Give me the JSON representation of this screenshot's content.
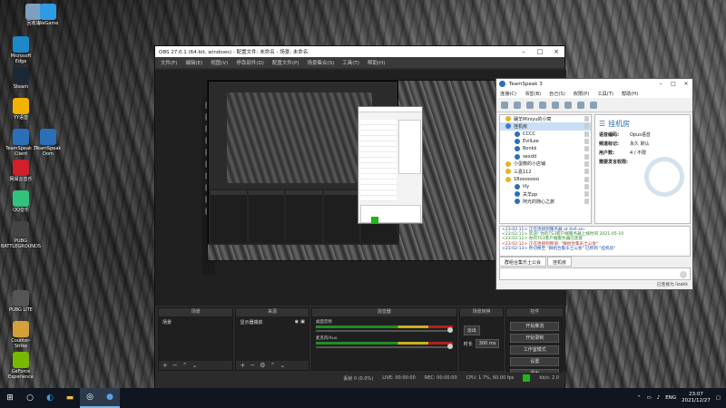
{
  "desktop": {
    "icons": [
      {
        "label": "回收站",
        "icon": "recycle-bin-icon",
        "color": "#7f9fbf"
      },
      {
        "label": "Microsoft Edge",
        "icon": "edge-icon",
        "color": "#1e88c8"
      },
      {
        "label": "Steam",
        "icon": "steam-icon",
        "color": "#1b2838"
      },
      {
        "label": "YY语音",
        "icon": "yy-icon",
        "color": "#f0b400"
      },
      {
        "label": "TeamSpeak 3 Client",
        "icon": "teamspeak-icon",
        "color": "#2a6fb8"
      },
      {
        "label": "网易云音乐",
        "icon": "netease-music-icon",
        "color": "#d0202a"
      },
      {
        "label": "QQ音乐",
        "icon": "qq-music-icon",
        "color": "#31c27c"
      },
      {
        "label": "PUBG BATTLEGROUNDS",
        "icon": "pubg-icon",
        "color": "#444444"
      },
      {
        "label": "PUBG LITE",
        "icon": "pubg-lite-icon",
        "color": "#555555"
      },
      {
        "label": "Counter-Strike",
        "icon": "cs-icon",
        "color": "#d4a03a"
      },
      {
        "label": "GeForce Experience",
        "icon": "geforce-icon",
        "color": "#76b900"
      },
      {
        "label": "WeGame",
        "icon": "wegame-icon",
        "color": "#2e9be4"
      },
      {
        "label": "TeamSpeak Dom",
        "icon": "teamspeak-icon",
        "color": "#2a6fb8"
      }
    ]
  },
  "obs": {
    "title": "OBS 27.0.1 (64-bit, windows) - 配置文件: 未命名 - 场景: 未命名",
    "menu": [
      "文件(F)",
      "编辑(E)",
      "视图(V)",
      "停靠部件(D)",
      "配置文件(P)",
      "场景集合(S)",
      "工具(T)",
      "帮助(H)"
    ],
    "panels": {
      "scenes": {
        "title": "场景",
        "items": [
          "场景"
        ]
      },
      "sources": {
        "title": "来源",
        "items": [
          "显示器捕获"
        ]
      },
      "mixer": {
        "title": "混音器",
        "tracks": [
          {
            "name": "桌面音频",
            "level": 0.7
          },
          {
            "name": "麦克风/Aux",
            "level": 0.6
          }
        ]
      },
      "transitions": {
        "title": "场景转换",
        "type": "淡出",
        "duration_label": "时长",
        "duration": "300 ms"
      },
      "controls": {
        "title": "控件",
        "buttons": [
          "开始推流",
          "开始录制",
          "工作室模式",
          "设置",
          "退出"
        ]
      }
    },
    "status": {
      "dropped": "丢帧 0 (0.0%)",
      "live": "LIVE: 00:00:00",
      "rec": "REC: 00:00:00",
      "cpu": "CPU: 1.7%, 60.00 fps",
      "kbs": "kb/s: 2.0",
      "ok_color": "#1db41d"
    }
  },
  "teamspeak": {
    "title": "TeamSpeak 3",
    "menu": [
      "连接(C)",
      "书签(B)",
      "自己(S)",
      "权限(P)",
      "工具(T)",
      "帮助(H)"
    ],
    "tree": [
      {
        "label": "碾羊Miniyu的小窝",
        "icon_color": "#e6b422"
      },
      {
        "label": "挂机房",
        "icon_color": "#3b7bd0",
        "selected": true
      },
      {
        "label": "CCCC",
        "icon_color": "#2a6fb8"
      },
      {
        "label": "EvilLee",
        "icon_color": "#2a6fb8"
      },
      {
        "label": "Bonkk",
        "icon_color": "#2a6fb8"
      },
      {
        "label": "xexdd",
        "icon_color": "#2a6fb8"
      },
      {
        "label": "小蛋糕的小店铺",
        "icon_color": "#e6b422"
      },
      {
        "label": "三嘉112",
        "icon_color": "#e6b422"
      },
      {
        "label": "1Booooooo",
        "icon_color": "#e6b422"
      },
      {
        "label": "lily",
        "icon_color": "#2a6fb8"
      },
      {
        "label": "关羊pp",
        "icon_color": "#2a6fb8"
      },
      {
        "label": "阿光的随心之旅",
        "icon_color": "#2a6fb8"
      }
    ],
    "info": {
      "channel": "挂机房",
      "rows": [
        {
          "k": "语音编码:",
          "v": "Opus语音"
        },
        {
          "k": "频道标记:",
          "v": "永久 默认"
        },
        {
          "k": "用户数:",
          "v": "4 / 不限"
        },
        {
          "k": "需要发言权限:",
          "v": ""
        }
      ]
    },
    "chat": [
      "<23:02:11> 正在连接到服务器 at 4x6.xin",
      "<23:02:11> 欢迎! 你的TS3客户端服务器上线时间 2021-05-10",
      "<23:02:12> 你的TS3客户端服务器已连接",
      "<23:02:12> 正在连接到频道: \"群组合集乐土公会\"",
      "<23:02:13> 你切换至 \"群组合集乐土公会\" 已移到 \"挂机房\""
    ],
    "tabs": [
      "群组合集乐土公会",
      "挂机房"
    ],
    "status": "已连接为 lizakk"
  },
  "taskbar": {
    "items": [
      "start-icon",
      "search-icon",
      "edge-icon",
      "file-explorer-icon",
      "obs-icon",
      "teamspeak-icon"
    ],
    "lang": "ENG",
    "time": "23:07",
    "date": "2021/12/27"
  }
}
